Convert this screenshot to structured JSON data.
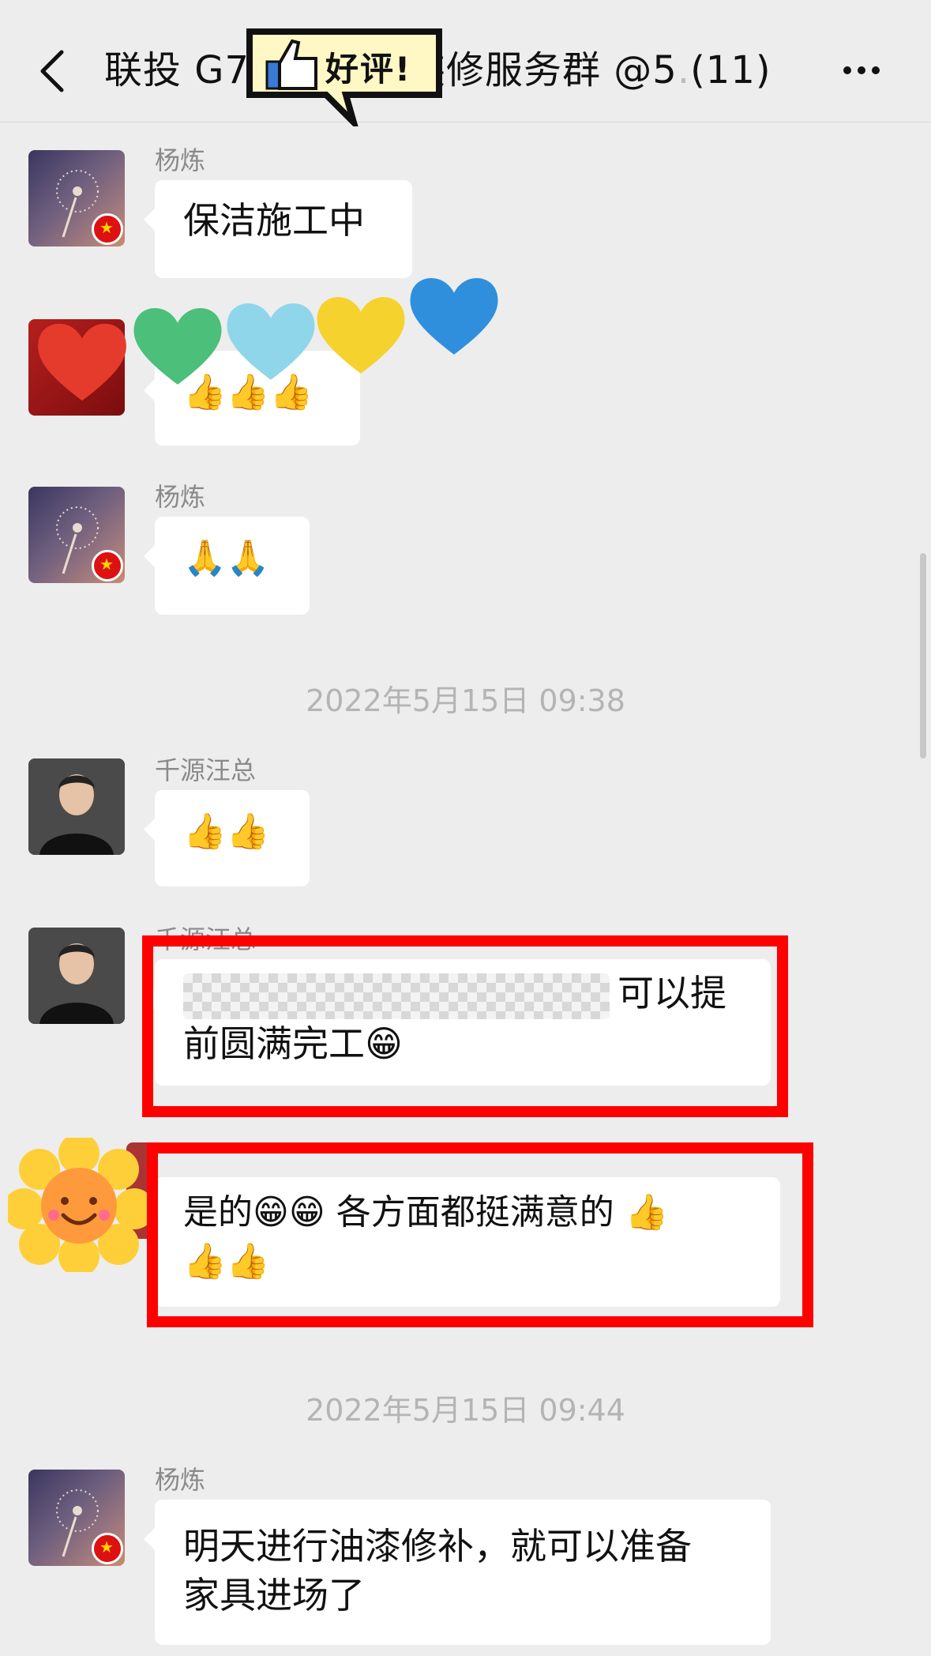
{
  "header": {
    "title_part1": "联投 G7",
    "title_part2": "装修服务群 @5",
    "title_fade": ".",
    "title_count": "(11)"
  },
  "sticker": {
    "label": "好评!"
  },
  "messages": [
    {
      "sender": "杨炼",
      "text": "保洁施工中"
    },
    {
      "sender": "",
      "text": "👍👍👍"
    },
    {
      "sender": "杨炼",
      "text": "🙏🙏"
    },
    {
      "sender": "千源汪总",
      "text": "👍👍"
    },
    {
      "sender": "千源汪总",
      "text_suffix": "可以提",
      "text_line2": "前圆满完工😁"
    },
    {
      "sender": "",
      "text": "是的😁😁 各方面都挺满意的 👍",
      "text_line2": "👍👍"
    },
    {
      "sender": "杨炼",
      "text": "明天进行油漆修补，就可以准备",
      "text_line2": "家具进场了"
    }
  ],
  "timestamps": [
    "2022年5月15日 09:38",
    "2022年5月15日 09:44"
  ],
  "colors": {
    "highlight": "#ff0000",
    "bubble": "#ffffff",
    "background": "#ededed"
  },
  "icons": [
    "back-icon",
    "more-icon",
    "thumbs-up-icon",
    "china-flag-icon",
    "heart-sticker",
    "sun-sticker"
  ]
}
